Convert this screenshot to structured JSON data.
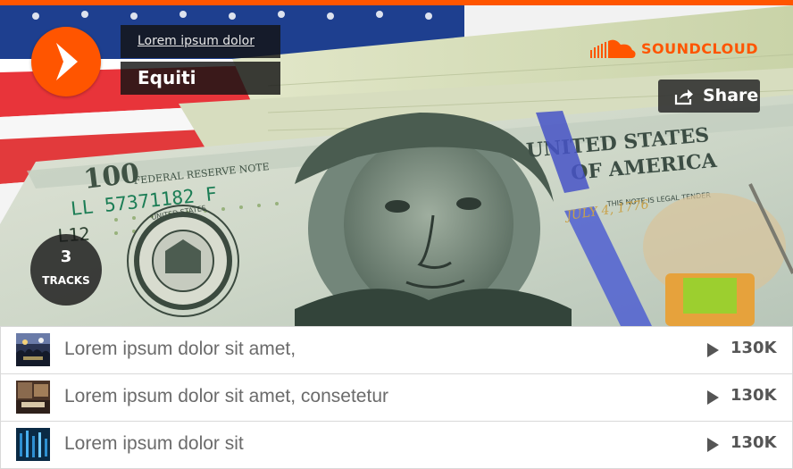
{
  "header": {
    "user_name": "Lorem ipsum dolor",
    "playlist_title": "Equiti",
    "brand_name": "SOUNDCLOUD",
    "share_label": "Share",
    "track_count": "3",
    "track_count_label": "TRACKS"
  },
  "banknote": {
    "serial_number": "LL 57371182 F",
    "serial_prefix": "L12",
    "note_value": "100",
    "seal_text": "UNITED STATES FEDERAL RESERVE SYSTEM",
    "note_caption": "FEDERAL RESERVE NOTE",
    "legal_tender_text": "THIS NOTE IS LEGAL TENDER FOR ALL DEBTS, PUBLIC AND PRIVATE",
    "united_states_text": "UNITED STATES OF AMERICA",
    "date_text": "JULY 4, 1776"
  },
  "tracks": [
    {
      "title": "Lorem ipsum dolor sit amet,",
      "plays": "130K",
      "thumb": "concert-crowd-thumbnail"
    },
    {
      "title": "Lorem ipsum dolor sit amet, consetetur",
      "plays": "130K",
      "thumb": "interior-room-thumbnail"
    },
    {
      "title": "Lorem ipsum dolor sit",
      "plays": "130K",
      "thumb": "blue-abstract-thumbnail"
    }
  ],
  "colors": {
    "accent": "#ff5500",
    "panel": "#141414",
    "track_text": "#6b6b6b"
  }
}
